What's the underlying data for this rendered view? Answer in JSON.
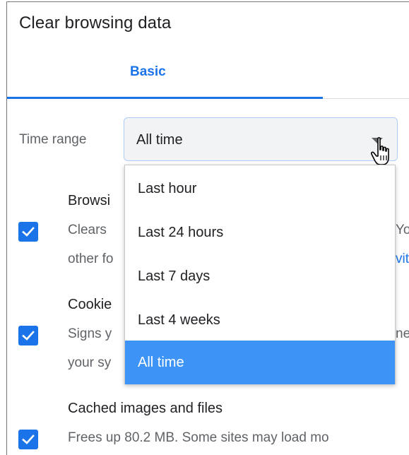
{
  "dialog": {
    "title": "Clear browsing data"
  },
  "tabs": [
    {
      "label": "Basic",
      "active": true
    }
  ],
  "time_range": {
    "label": "Time range",
    "selected": "All time",
    "icon": "dropdown-arrow-icon"
  },
  "dropdown": {
    "options": [
      {
        "label": "Last hour",
        "selected": false
      },
      {
        "label": "Last 24 hours",
        "selected": false
      },
      {
        "label": "Last 7 days",
        "selected": false
      },
      {
        "label": "Last 4 weeks",
        "selected": false
      },
      {
        "label": "All time",
        "selected": true
      }
    ]
  },
  "options": [
    {
      "checked": true,
      "title": "Browsi",
      "desc_line1": "Clears",
      "desc_line1_right": "Yo",
      "desc_line2": "other fo",
      "desc_line2_right": "vit"
    },
    {
      "checked": true,
      "title": "Cookie",
      "desc_line1": "Signs y",
      "desc_line1_right": "ne",
      "desc_line2": "your sy"
    },
    {
      "checked": true,
      "title": "Cached images and files",
      "desc_line1": "Frees up 80.2 MB. Some sites may load mo"
    }
  ],
  "colors": {
    "accent": "#1a73e8",
    "selected_option": "#3d94f6"
  },
  "cursor": "hand-pointer-icon"
}
